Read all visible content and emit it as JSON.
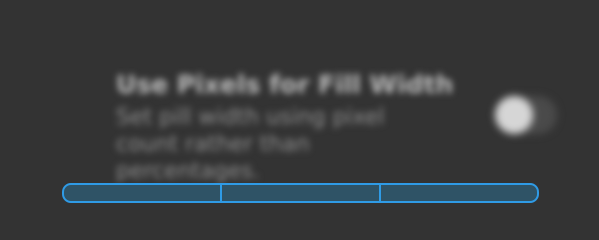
{
  "setting": {
    "title": "Use Pixels for Fill Width",
    "description": "Set pill width using pixel count rather than percentages.",
    "toggle_state": "on"
  },
  "segmented_control": {
    "segments": [
      "",
      "",
      ""
    ],
    "accent_color": "#2f9be6"
  },
  "colors": {
    "background": "#333333",
    "title": "#bdbdbd",
    "description": "#8f8f8f"
  }
}
